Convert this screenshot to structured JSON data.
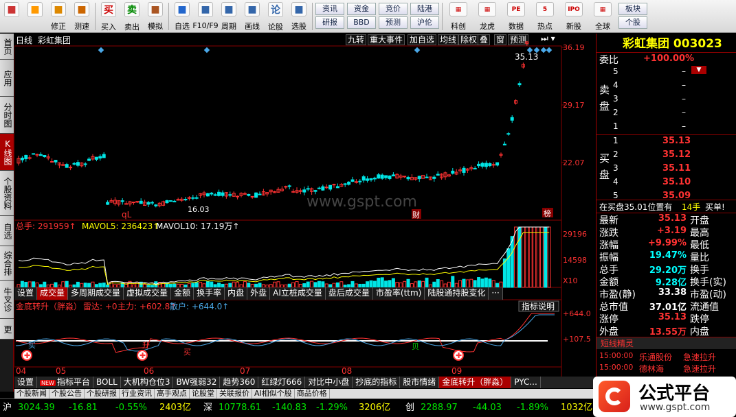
{
  "toolbar": {
    "items": [
      {
        "label": "",
        "icon": "grid-icon"
      },
      {
        "label": "",
        "icon": "back-arrow-icon"
      },
      {
        "label": "修正",
        "icon": "edit-icon"
      },
      {
        "label": "测速",
        "icon": "clock-icon"
      },
      {
        "label": "买入",
        "icon": "buy-icon",
        "glyph": "买"
      },
      {
        "label": "卖出",
        "icon": "sell-icon",
        "glyph": "卖"
      },
      {
        "label": "模拟",
        "icon": "hammer-icon"
      },
      {
        "label": "自选",
        "icon": "star-icon"
      },
      {
        "label": "F10/F9",
        "icon": "f10-icon"
      },
      {
        "label": "周期",
        "icon": "cycle-icon"
      },
      {
        "label": "画线",
        "icon": "pen-icon"
      },
      {
        "label": "论股",
        "icon": "discuss-icon",
        "glyph": "论"
      },
      {
        "label": "选股",
        "icon": "select-stock-icon"
      }
    ],
    "pairs": [
      [
        "资讯",
        "研报"
      ],
      [
        "资金",
        "BBD"
      ],
      [
        "竞价",
        "预测"
      ],
      [
        "陆港",
        "沪伦"
      ]
    ],
    "right_items": [
      {
        "label": "科创",
        "icon": "kechuang-icon"
      },
      {
        "label": "龙虎",
        "icon": "dragon-icon"
      },
      {
        "label": "数据",
        "icon": "data-icon",
        "glyph": "PE"
      },
      {
        "label": "热点",
        "icon": "hotspot-icon",
        "glyph": "5"
      },
      {
        "label": "新股",
        "icon": "ipo-icon",
        "glyph": "IPO"
      },
      {
        "label": "全球",
        "icon": "globe-icon"
      }
    ],
    "last_pair": [
      "板块",
      "个股"
    ]
  },
  "sidebar": [
    "首页",
    "应用",
    "分时图",
    "K线图",
    "个股资料",
    "自选股",
    "综合排名",
    "牛叉诊股",
    "更多"
  ],
  "chart": {
    "period": "日线",
    "name": "彩虹集团",
    "buttons": [
      "九转",
      "重大事件",
      "加自选",
      "均线",
      "除权",
      "叠",
      "窗",
      "预测"
    ],
    "price_ticks": [
      "36.19",
      "29.17",
      "22.07"
    ],
    "last_label": "35.13",
    "low_label": "16.03",
    "ql": "qL",
    "cai": "财",
    "bang": "榜",
    "vol_header": {
      "total": "总手: 291959↑",
      "ma5": "MAVOL5: 236423↑",
      "ma10": "MAVOL10: 17.19万↑"
    },
    "vol_ticks": [
      "29196",
      "14598"
    ],
    "x10": "X10",
    "vol_tabs": [
      "设置",
      "成交量",
      "多周期成交量",
      "虚拟成交量",
      "金额",
      "换手率",
      "内盘",
      "外盘",
      "AI立桩成交量",
      "盘后成交量",
      "市盈率(ttm)",
      "陆股通持股变化",
      "···"
    ],
    "ind_header": {
      "name": "金底转升（胖淼）",
      "leida": "雷达: +0",
      "zhuli": "主力: +602.8↑",
      "sanhu": "散户: +644.0↑"
    },
    "ind_explain": "指标说明",
    "ind_ticks": [
      "+644.0",
      "+107.5"
    ],
    "months": [
      "04",
      "05",
      "06",
      "07",
      "08",
      "09"
    ],
    "markers": {
      "buy1": "买",
      "buy2": "升",
      "buy3": "买",
      "buy4": "贝"
    }
  },
  "bottom_tabs": [
    "设置",
    "指标平台",
    "BOLL",
    "大机构仓位3",
    "BW强弱32",
    "趋势360",
    "红绿灯666",
    "对比中小盘",
    "抄底的指标",
    "股市情绪",
    "金底转升（胖淼）",
    "PYC..."
  ],
  "new_tag": "NEW",
  "links": [
    "个股新闻",
    "个股公告",
    "个股研报",
    "行业资讯",
    "高手观点",
    "论股堂",
    "关联报价",
    "AI相似个股",
    "商品价格"
  ],
  "right": {
    "title": "彩虹集团 003023",
    "weibi_label": "委比",
    "weibi": "+100.00%",
    "sell_label": "卖盘",
    "buy_label": "买盘",
    "sell": [
      [
        "5",
        "–"
      ],
      [
        "4",
        "–"
      ],
      [
        "3",
        "–"
      ],
      [
        "2",
        "–"
      ],
      [
        "1",
        "–"
      ]
    ],
    "buy": [
      [
        "1",
        "35.13"
      ],
      [
        "2",
        "35.12"
      ],
      [
        "3",
        "35.11"
      ],
      [
        "4",
        "35.10"
      ],
      [
        "5",
        "35.09"
      ]
    ],
    "inbuy": "在买盘35.01位置有",
    "inbuy_vol": "14手",
    "inbuy_tag": "买单!",
    "stats": [
      [
        "最新",
        "35.13",
        "开盘"
      ],
      [
        "涨跌",
        "+3.19",
        "最高"
      ],
      [
        "涨幅",
        "+9.99%",
        "最低"
      ],
      [
        "振幅",
        "19.47%",
        "量比"
      ],
      [
        "总手",
        "29.20万",
        "换手"
      ],
      [
        "金额",
        "9.28亿",
        "换手(实)"
      ],
      [
        "市盈(静)",
        "33.38",
        "市盈(动)"
      ],
      [
        "总市值",
        "37.01亿",
        "流通值"
      ],
      [
        "涨停",
        "35.13",
        "跌停"
      ],
      [
        "外盘",
        "13.55万",
        "内盘"
      ]
    ],
    "jingling": "短线精灵",
    "alerts": [
      [
        "15:00:00",
        "乐通股份",
        "急速拉升"
      ],
      [
        "15:00:00",
        "德林海",
        "急速拉升"
      ]
    ]
  },
  "status": {
    "sh": "沪",
    "sh_val": "3024.39",
    "sh_chg": "-16.81",
    "sh_pct": "-0.55%",
    "sh_amt": "2403亿",
    "sz": "深",
    "sz_val": "10778.61",
    "sz_chg": "-140.83",
    "sz_pct": "-1.29%",
    "sz_amt": "3206亿",
    "cy": "创",
    "cy_val": "2288.97",
    "cy_chg": "-44.03",
    "cy_pct": "-1.89%",
    "cy_amt": "1032亿"
  },
  "watermark": "www.gspt.com",
  "logo": {
    "brand": "公式平台",
    "url": "www.gspt.com"
  },
  "colors": {
    "up": "#ff3232",
    "down": "#00e6e6",
    "accent": "#a00000"
  }
}
